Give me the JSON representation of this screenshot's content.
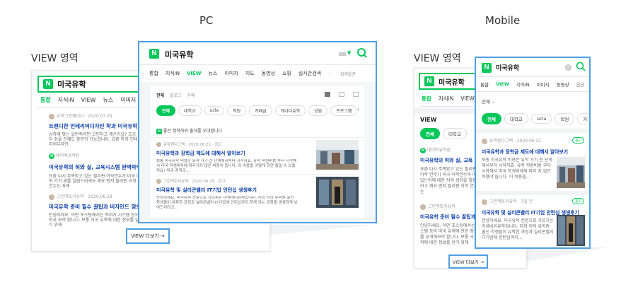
{
  "labels": {
    "pc": "PC",
    "mobile": "Mobile",
    "view_area_pc": "VIEW 영역",
    "view_area_mobile": "VIEW 영역"
  },
  "colors": {
    "brand": "#03c75a",
    "highlight": "#4f9fe0",
    "link": "#0a3da8"
  },
  "query": "미국유학",
  "pc_bg": {
    "tabs": [
      "통합",
      "지식iN",
      "VIEW",
      "뉴스",
      "이미지",
      "지"
    ],
    "posts": [
      {
        "author": "유학그린웨이다",
        "date": "2020.07.29",
        "title": "트렌디한 인테리어디자인 학과 미국유학 알아",
        "desc": "상하에 맞는 일반적과떤 고민하고 계신가요? 조금 더 쉬울 인재도 충분히 가능합니다. 요즘 특히 인테리어디자인"
      },
      {
        "author": "네이버유학원",
        "date": "2020.06.23",
        "title": "미국유학의 허와 실, 교육시스템 완벽파악",
        "desc": "요즘 다시 주목받고 있는 필리핀 어학연수가 미국 어학 기가 새를 알림드리세요 해요 먼저 필리핀 어학 연수는 자에"
      },
      {
        "author": "그린맥토리유학",
        "date": "2020.06.29",
        "title": "미국유학 준비 필수 꿀팁과 비자인드 정보",
        "desc": "안녕하세요. 어떤 포스팅에서는 적혀서 시스템 등의 미국 보려 합니다. 보통 미국 유학에 대한 정보를 알기 위해"
      }
    ]
  },
  "pc": {
    "tabs": [
      "통합",
      "지식iN",
      "VIEW",
      "뉴스",
      "이미지",
      "지도",
      "동영상",
      "쇼핑",
      "실시간검색",
      "···",
      "검색옵션"
    ],
    "filters": [
      "전체",
      "블로그",
      "카페"
    ],
    "chips": [
      "전체",
      "대학교",
      "ucla",
      "학원",
      "카페글",
      "캐나다유학",
      "상담",
      "프로그램",
      "유"
    ],
    "notice": "좋은 정착하와 출처를 우대합니다",
    "posts": [
      {
        "author": "유학원다그백",
        "date": "2020.06.21",
        "ad": "광고",
        "title": "미국유학과 장학금 제도에 대해서 알아보기",
        "desc": "보통 미국유학 비용은 유학 가기 전 단계에서부터 시작하죠. 유학 학원비용 부터 시작해서 미국 학생비자에 따라가지 않은 비용이 듭니다. 이 비용을 어떻게 하면 줄일 수 있을까요? 미국 장학금..."
      },
      {
        "author": "그린맥토리유학",
        "date": "2020.06.29",
        "ad": "광고",
        "title": "미국유학 및 실리콘밸리 IT기업 인턴십 생생후기",
        "desc": "안녕하세요. 미국유학 전문으로 가르치는 어셈네이유학입니다. 저희 저의 유학원 출신 학생들이 유학한 과정과 실리콘밸리 IT기업에 인턴십까지 하게 되는 과정을 생생하게 보여드리려고..."
      }
    ],
    "more": "VIEW 더보기 →"
  },
  "mobile_bg": {
    "tabs": [
      "통합",
      "지식iN",
      "VIEW"
    ],
    "section": "VIEW",
    "chips": [
      "전체",
      "대학교"
    ],
    "posts": [
      {
        "author": "네이버유학원",
        "title": "미국유학의 허와 실, 교육",
        "desc": "요즘 다시 주목받고 있는 필리핀 어학 연수가 미국 어학연수와 어떤 있는지에 대한 저의 생각을 말씀 려고 해요 먼저 필리핀 어학 연수는"
      },
      {
        "author": "그린맥토리유학",
        "title": "미국유학 준비 필수 꿀팁과",
        "desc": "안녕하세요. 어떤 포스팅에서는 시스템 등의 미국 유학에 관한 정보를 공개해보려 합니다. 보통 국 유학에 대한 정보를 얻기 위해"
      }
    ],
    "more": "VIEW 더보기 →"
  },
  "mobile": {
    "tabs": [
      "통합",
      "VIEW",
      "지식iN",
      "이미지",
      "동영상",
      "옵션"
    ],
    "filter": "전체",
    "chips": [
      "전체",
      "대학교",
      "ucla",
      "학원",
      "카페글",
      "캐"
    ],
    "posts": [
      {
        "author": "유학원다그백",
        "date": "2020.06.21",
        "badge": "광고",
        "title": "미국유학과 장학금 제도에 대해서 알아보기",
        "desc": "보통 미국유학 비용은 유학 가기 전 단계에서부터 시작하죠. 유학 학원비용 부터 시작해서 미국 학생비자에 따라 지 않은 비용이 듭니다. 이 비용을..."
      },
      {
        "author": "그린맥토리유학",
        "date": "7일 전",
        "badge": "광고",
        "title": "미국유학 및 실리콘밸리 IT기업 인턴십 생생후기",
        "desc": "안녕하세요. 미국유학 전문으로 가르치는 어셈네이유학입니다. 저희 저의 유학원 출신 학생들이 유학한 과정과 실리콘밸리 IT기업에 인턴십까지..."
      }
    ]
  }
}
